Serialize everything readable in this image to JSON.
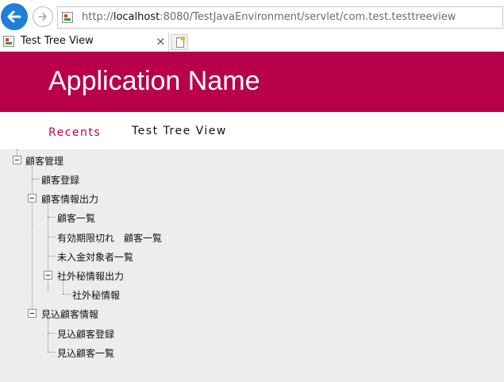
{
  "browser": {
    "url_host": "localhost",
    "url_rest": ":8080/TestJavaEnvironment/servlet/com.test.testtreeview",
    "url_prefix": "http://",
    "tab_title": "Test Tree View",
    "tab_close": "×"
  },
  "header": {
    "title": "Application Name"
  },
  "nav": {
    "recents": "Recents",
    "current": "Test Tree View"
  },
  "tree": {
    "n1": "顧客管理",
    "n1_1": "顧客登録",
    "n1_2": "顧客情報出力",
    "n1_2_1": "顧客一覧",
    "n1_2_2": "有効期限切れ　顧客一覧",
    "n1_2_3": "未入金対象者一覧",
    "n1_2_4": "社外秘情報出力",
    "n1_2_4_1": "社外秘情報",
    "n1_3": "見込顧客情報",
    "n1_3_1": "見込顧客登録",
    "n1_3_2": "見込顧客一覧"
  },
  "colors": {
    "accent": "#b9004b",
    "browser_blue": "#1f7fd6"
  }
}
